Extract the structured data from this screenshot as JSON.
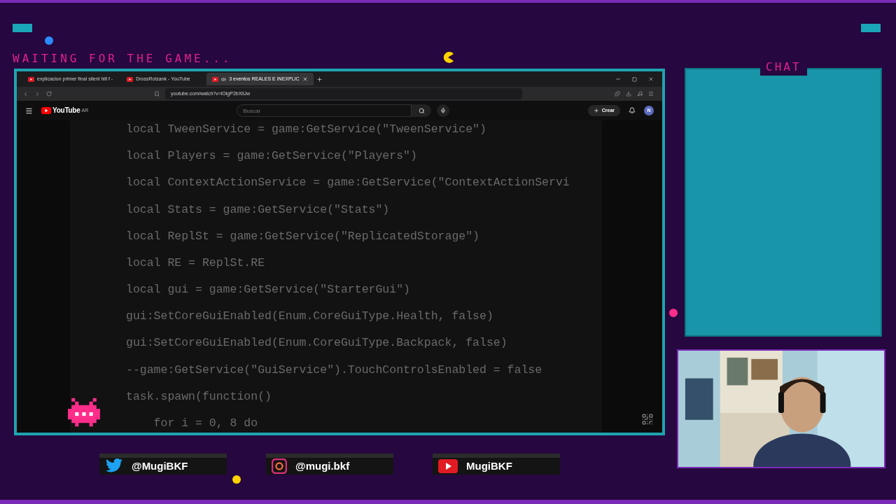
{
  "overlay": {
    "status_text": "WAITING FOR THE GAME...",
    "chat_title": "CHAT"
  },
  "browser": {
    "tabs": [
      {
        "title": "explicacion primer final silent hill f -",
        "selected": false,
        "audio": false
      },
      {
        "title": "DrossRotzank - YouTube",
        "selected": false,
        "audio": false
      },
      {
        "title": "3 eventos REALES E INEXPLIC",
        "selected": true,
        "audio": true
      }
    ],
    "address": "youtube.com/watch?v=lOigP2bXiUw"
  },
  "youtube": {
    "logo": "YouTube",
    "region": "AR",
    "search": {
      "placeholder": "Buscar"
    },
    "create_label": "Crear",
    "avatar": "N"
  },
  "code_lines": [
    "local TweenService = game:GetService(\"TweenService\")",
    "local Players = game:GetService(\"Players\")",
    "local ContextActionService = game:GetService(\"ContextActionServi",
    "local Stats = game:GetService(\"Stats\")",
    "local ReplSt = game:GetService(\"ReplicatedStorage\")",
    "local RE = ReplSt.RE",
    "local gui = game:GetService(\"StarterGui\")",
    "gui:SetCoreGuiEnabled(Enum.CoreGuiType.Health, false)",
    "gui:SetCoreGuiEnabled(Enum.CoreGuiType.Backpack, false)",
    "--game:GetService(\"GuiService\").TouchControlsEnabled = false",
    "task.spawn(function()",
    "    for i = 0, 8 do"
  ],
  "socials": [
    {
      "kind": "twitter",
      "handle": "@MugiBKF"
    },
    {
      "kind": "instagram",
      "handle": "@mugi.bkf"
    },
    {
      "kind": "youtube",
      "handle": "MugiBKF"
    }
  ]
}
